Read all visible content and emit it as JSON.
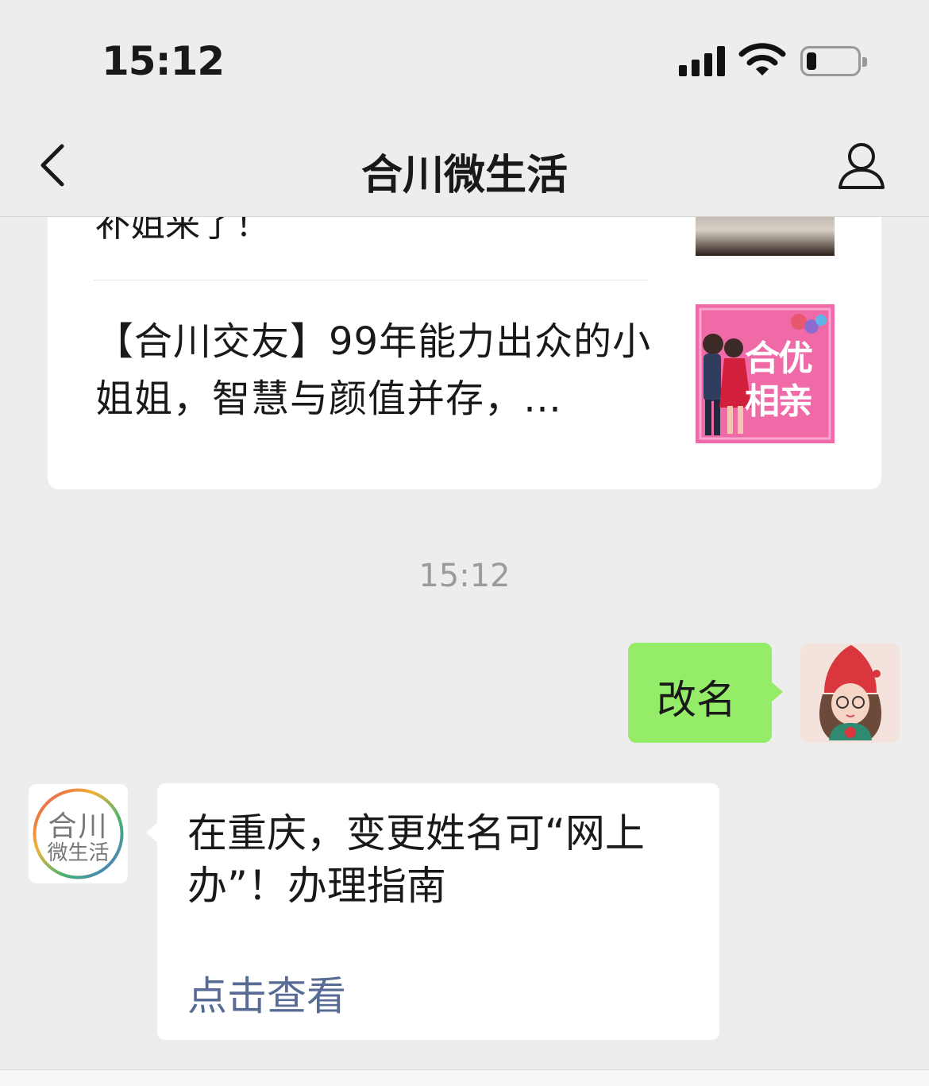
{
  "status_bar": {
    "time": "15:12"
  },
  "nav": {
    "title": "合川微生活"
  },
  "article_card": {
    "partial_title": "补姐来了！",
    "title": "【合川交友】99年能力出众的小姐姐，智慧与颜值并存，…",
    "thumb_text_line1": "合优",
    "thumb_text_line2": "相亲"
  },
  "chat": {
    "timestamp": "15:12",
    "sent_message": "改名",
    "received_message": "在重庆，变更姓名可“网上办”！办理指南",
    "received_link": "点击查看",
    "oa_avatar_line1": "合川",
    "oa_avatar_line2": "微生活"
  },
  "colors": {
    "background": "#ededed",
    "sent_bubble": "#95ec69",
    "link": "#576b95",
    "timestamp": "#9b9b9b"
  },
  "icons": {
    "back": "chevron-left-icon",
    "profile": "person-icon",
    "signal": "cellular-signal-icon",
    "wifi": "wifi-icon",
    "battery": "battery-icon"
  }
}
